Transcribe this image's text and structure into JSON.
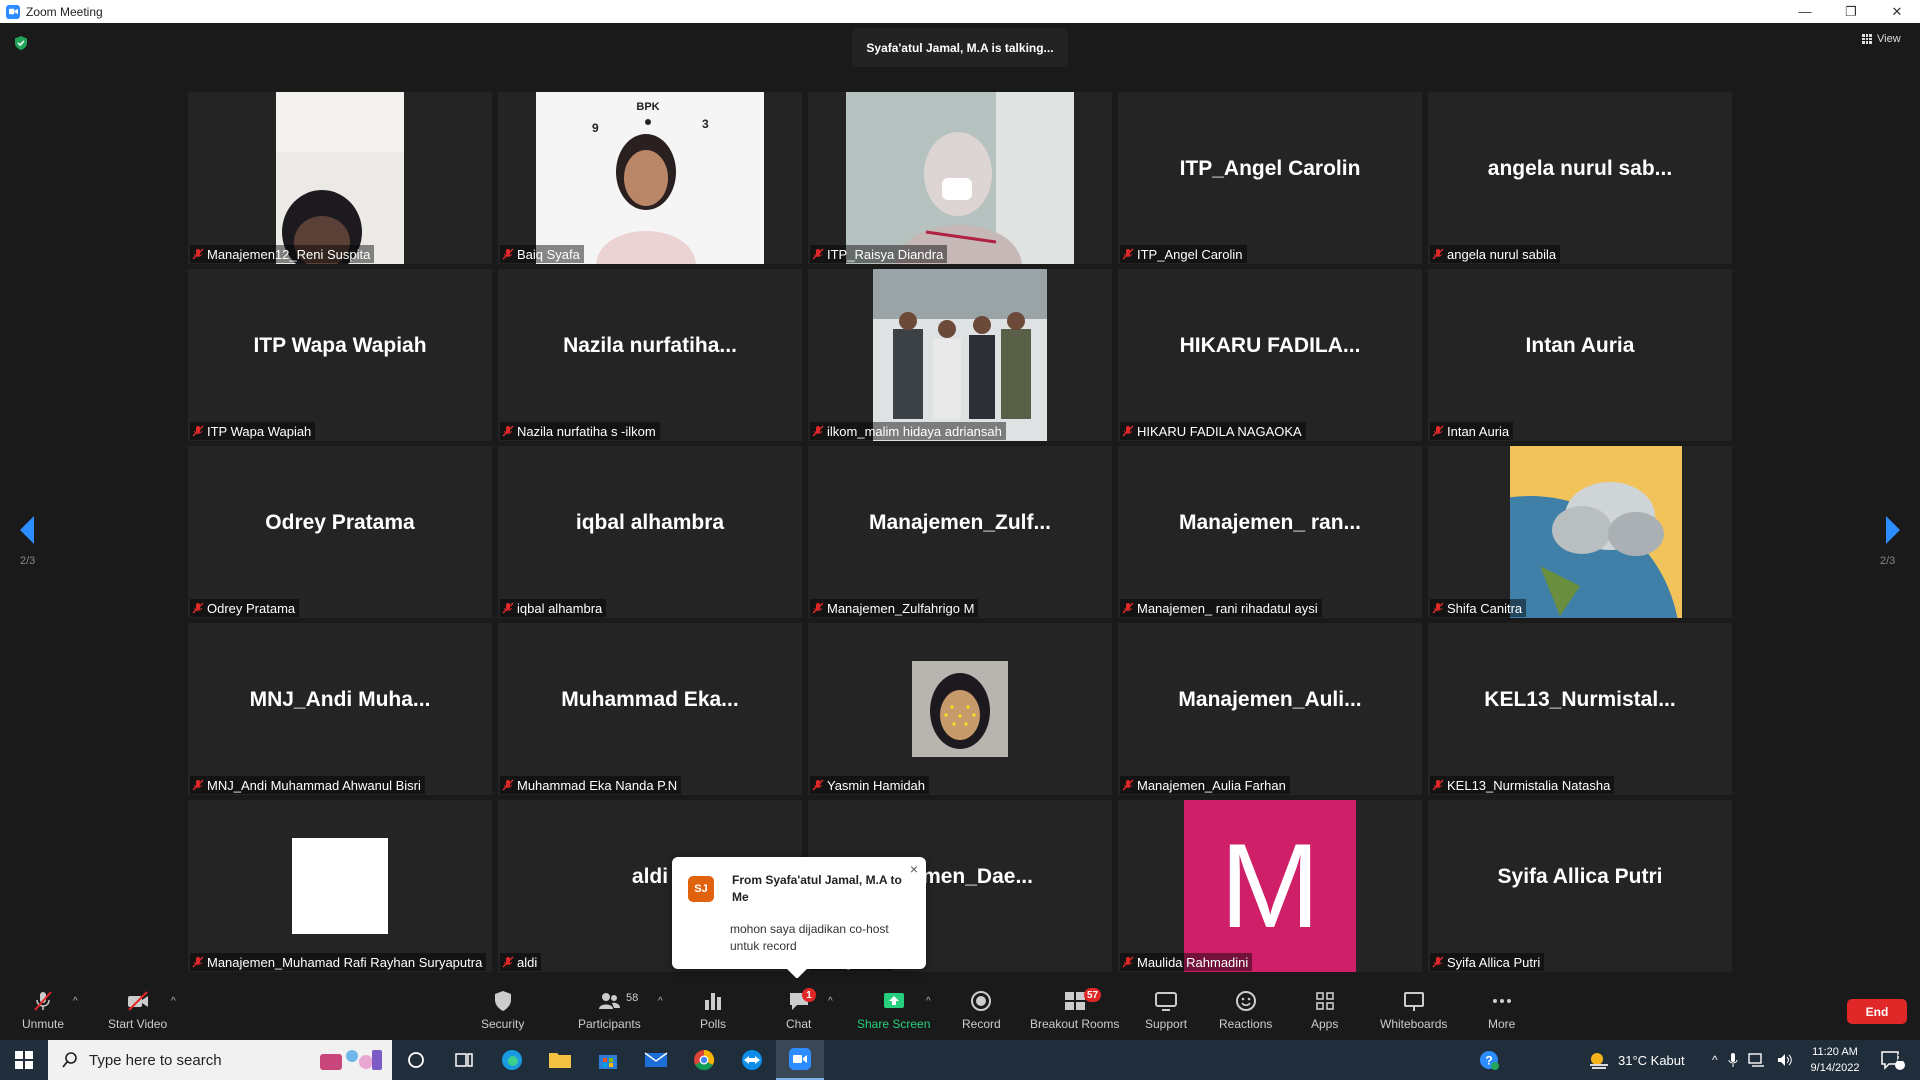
{
  "window": {
    "title": "Zoom Meeting",
    "controls": [
      "—",
      "❐",
      "✕"
    ]
  },
  "stage": {
    "talking": "Syafa'atul Jamal, M.A is talking...",
    "view_label": "View",
    "page_left": "2/3",
    "page_right": "2/3"
  },
  "tiles": [
    {
      "big": "",
      "label": "Manajemen12_Reni Suspita",
      "video": "reni"
    },
    {
      "big": "",
      "label": "Baiq Syafa",
      "video": "baiq"
    },
    {
      "big": "",
      "label": "ITP_Raisya Diandra",
      "video": "raisya"
    },
    {
      "big": "ITP_Angel Carolin",
      "label": "ITP_Angel Carolin",
      "video": ""
    },
    {
      "big": "angela nurul sab...",
      "label": "angela nurul sabila",
      "video": ""
    },
    {
      "big": "ITP Wapa Wapiah",
      "label": "ITP Wapa Wapiah",
      "video": ""
    },
    {
      "big": "Nazila  nurfatiha...",
      "label": "Nazila nurfatiha s -ilkom",
      "video": ""
    },
    {
      "big": "",
      "label": "ilkom_malim hidaya adriansah",
      "video": "group"
    },
    {
      "big": "HIKARU  FADILA...",
      "label": "HIKARU FADILA NAGAOKA",
      "video": ""
    },
    {
      "big": "Intan Auria",
      "label": "Intan Auria",
      "video": ""
    },
    {
      "big": "Odrey Pratama",
      "label": "Odrey Pratama",
      "video": ""
    },
    {
      "big": "iqbal alhambra",
      "label": "iqbal alhambra",
      "video": ""
    },
    {
      "big": "Manajemen_Zulf...",
      "label": "Manajemen_Zulfahrigo M",
      "video": ""
    },
    {
      "big": "Manajemen_  ran...",
      "label": "Manajemen_ rani rihadatul aysi",
      "video": ""
    },
    {
      "big": "",
      "label": "Shifa Canitra",
      "video": "cloud"
    },
    {
      "big": "MNJ_Andi  Muha...",
      "label": "MNJ_Andi Muhammad Ahwanul Bisri",
      "video": ""
    },
    {
      "big": "Muhammad  Eka...",
      "label": "Muhammad Eka Nanda P.N",
      "video": ""
    },
    {
      "big": "",
      "label": "Yasmin Hamidah",
      "video": "yasmin"
    },
    {
      "big": "Manajemen_Auli...",
      "label": "Manajemen_Aulia Farhan",
      "video": ""
    },
    {
      "big": "KEL13_Nurmistal...",
      "label": "KEL13_Nurmistalia Natasha",
      "video": ""
    },
    {
      "big": "",
      "label": "Manajemen_Muhamad Rafi Rayhan Suryaputra",
      "video": "white"
    },
    {
      "big": "aldi",
      "label": "aldi",
      "video": ""
    },
    {
      "big": "...jemen_Dae...",
      "label": "...ng danar",
      "video": ""
    },
    {
      "big": "",
      "label": "Maulida Rahmadini",
      "video": "m"
    },
    {
      "big": "Syifa Allica Putri",
      "label": "Syifa Allica Putri",
      "video": ""
    }
  ],
  "m_letter": "M",
  "chat_popup": {
    "initials": "SJ",
    "from": "From Syafa'atul Jamal, M.A to Me",
    "message": "mohon saya dijadikan co-host untuk record",
    "close": "×"
  },
  "toolbar": {
    "unmute": "Unmute",
    "start_video": "Start Video",
    "security": "Security",
    "participants": "Participants",
    "participant_count": "58",
    "polls": "Polls",
    "chat": "Chat",
    "chat_badge": "1",
    "share_screen": "Share Screen",
    "record": "Record",
    "breakout_rooms": "Breakout Rooms",
    "breakout_badge": "57",
    "support": "Support",
    "reactions": "Reactions",
    "apps": "Apps",
    "whiteboards": "Whiteboards",
    "more": "More",
    "end": "End"
  },
  "taskbar": {
    "search_placeholder": "Type here to search",
    "weather": "31°C  Kabut",
    "time": "11:20 AM",
    "date": "9/14/2022",
    "notif_count": "2"
  },
  "colors": {
    "accent": "#2d8cff",
    "end": "#e02828",
    "share": "#26d07c",
    "m_tile": "#d01f69"
  }
}
